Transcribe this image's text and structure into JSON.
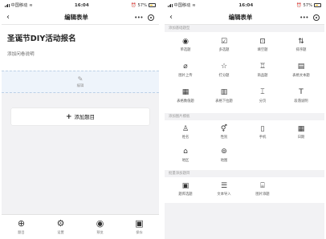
{
  "left": {
    "status": {
      "carrier": "中国移动",
      "time": "16:04",
      "battery": "57%"
    },
    "nav": {
      "back": "‹",
      "title": "编辑表单",
      "more": "•••"
    },
    "form": {
      "title": "圣诞节DIY活动报名",
      "description": "添加问卷说明"
    },
    "edit": {
      "icon": "✎",
      "label": "编辑"
    },
    "add_question": {
      "plus": "+",
      "label": "添加题目"
    },
    "tabs": [
      {
        "icon": "⊕",
        "label": "题目"
      },
      {
        "icon": "⚙",
        "label": "设置"
      },
      {
        "icon": "◉",
        "label": "预览"
      },
      {
        "icon": "▣",
        "label": "保存"
      }
    ]
  },
  "right": {
    "status": {
      "carrier": "中国移动",
      "time": "16:04",
      "battery": "57%"
    },
    "nav": {
      "back": "‹",
      "title": "编辑表单",
      "more": "•••"
    },
    "sections": [
      {
        "header": "添加基础题型",
        "items": [
          {
            "icon": "◉",
            "label": "单选题"
          },
          {
            "icon": "☑",
            "label": "多选题"
          },
          {
            "icon": "⊡",
            "label": "填空题"
          },
          {
            "icon": "⇅",
            "label": "排序题"
          },
          {
            "icon": "⌀",
            "label": "图片上传"
          },
          {
            "icon": "☆",
            "label": "打分题"
          },
          {
            "icon": "♖",
            "label": "商品题"
          },
          {
            "icon": "▤",
            "label": "表格文本题"
          },
          {
            "icon": "▦",
            "label": "表格数值题"
          },
          {
            "icon": "▥",
            "label": "表格下拉题"
          },
          {
            "icon": "⌶",
            "label": "分页"
          },
          {
            "icon": "T",
            "label": "段落说明"
          }
        ]
      },
      {
        "header": "添加图片模板",
        "items": [
          {
            "icon": "♙",
            "label": "姓名"
          },
          {
            "icon": "⚥",
            "label": "性别"
          },
          {
            "icon": "▯",
            "label": "手机"
          },
          {
            "icon": "▦",
            "label": "日期"
          },
          {
            "icon": "⌂",
            "label": "地区"
          },
          {
            "icon": "⊚",
            "label": "地图"
          }
        ]
      },
      {
        "header": "批量添加题目",
        "items": [
          {
            "icon": "▣",
            "label": "题库选题"
          },
          {
            "icon": "☰",
            "label": "文本导入"
          },
          {
            "icon": "⌸",
            "label": "图片添题"
          }
        ]
      }
    ]
  }
}
